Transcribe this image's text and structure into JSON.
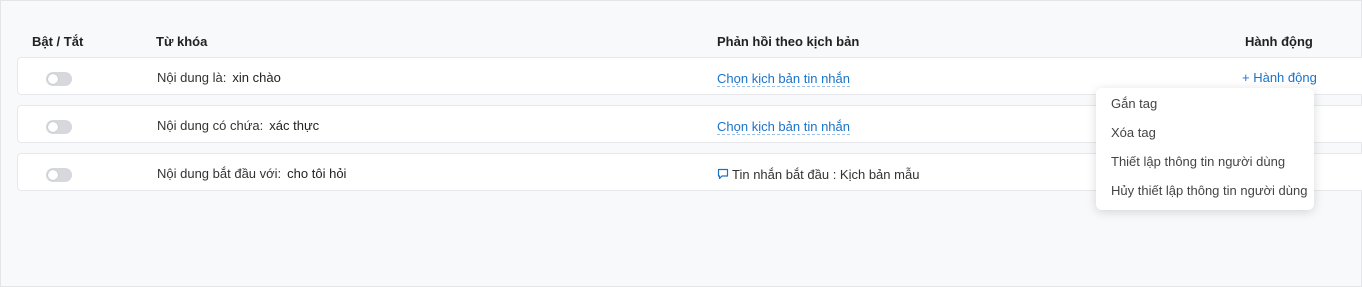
{
  "table": {
    "headers": {
      "toggle": "Bật / Tắt",
      "keyword": "Từ khóa",
      "response": "Phản hồi theo kịch bản",
      "action": "Hành động"
    },
    "rows": [
      {
        "enabled": false,
        "keyword_label": "Nội dung là:",
        "keyword_value": "xin chào",
        "response_text": "Chọn kịch bản tin nhắn",
        "response_type": "link",
        "action_label": "+ Hành động"
      },
      {
        "enabled": false,
        "keyword_label": "Nội dung có chứa:",
        "keyword_value": "xác thực",
        "response_text": "Chọn kịch bản tin nhắn",
        "response_type": "link"
      },
      {
        "enabled": false,
        "keyword_label": "Nội dung bắt đầu với:",
        "keyword_value": "cho tôi hỏi",
        "response_text": "Tin nhắn bắt đầu : Kịch bản mẫu",
        "response_type": "text",
        "response_icon": "chat-bubble-icon"
      }
    ]
  },
  "action_menu": {
    "items": [
      "Gắn tag",
      "Xóa tag",
      "Thiết lập thông tin người dùng",
      "Hủy thiết lập thông tin người dùng"
    ]
  },
  "colors": {
    "link": "#1a73c9",
    "toggle_off": "#d6d8db",
    "background": "#f8f9fa"
  }
}
